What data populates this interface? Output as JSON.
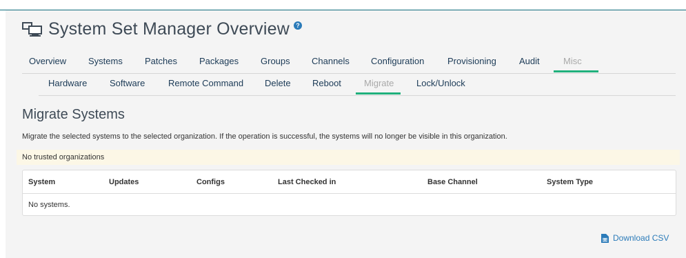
{
  "page": {
    "title": "System Set Manager Overview",
    "help_icon": "question-circle-icon",
    "system_icon": "desktop-icon"
  },
  "nav": {
    "tabs": [
      {
        "label": "Overview"
      },
      {
        "label": "Systems"
      },
      {
        "label": "Patches"
      },
      {
        "label": "Packages"
      },
      {
        "label": "Groups"
      },
      {
        "label": "Channels"
      },
      {
        "label": "Configuration"
      },
      {
        "label": "Provisioning"
      },
      {
        "label": "Audit"
      },
      {
        "label": "Misc"
      }
    ],
    "active": "Misc"
  },
  "subnav": {
    "tabs": [
      {
        "label": "Hardware"
      },
      {
        "label": "Software"
      },
      {
        "label": "Remote Command"
      },
      {
        "label": "Delete"
      },
      {
        "label": "Reboot"
      },
      {
        "label": "Migrate"
      },
      {
        "label": "Lock/Unlock"
      }
    ],
    "active": "Migrate"
  },
  "section": {
    "title": "Migrate Systems",
    "description": "Migrate the selected systems to the selected organization. If the operation is successful, the systems will no longer be visible in this organization."
  },
  "alert": {
    "text": "No trusted organizations"
  },
  "table": {
    "columns": [
      "System",
      "Updates",
      "Configs",
      "Last Checked in",
      "Base Channel",
      "System Type"
    ],
    "empty_text": "No systems."
  },
  "download": {
    "label": "Download CSV",
    "icon": "file-spreadsheet-icon"
  },
  "colors": {
    "accent": "#20b07c",
    "link": "#2b7bb9",
    "nav_text": "#1b3a56",
    "alert_bg": "#fcf7e6"
  }
}
